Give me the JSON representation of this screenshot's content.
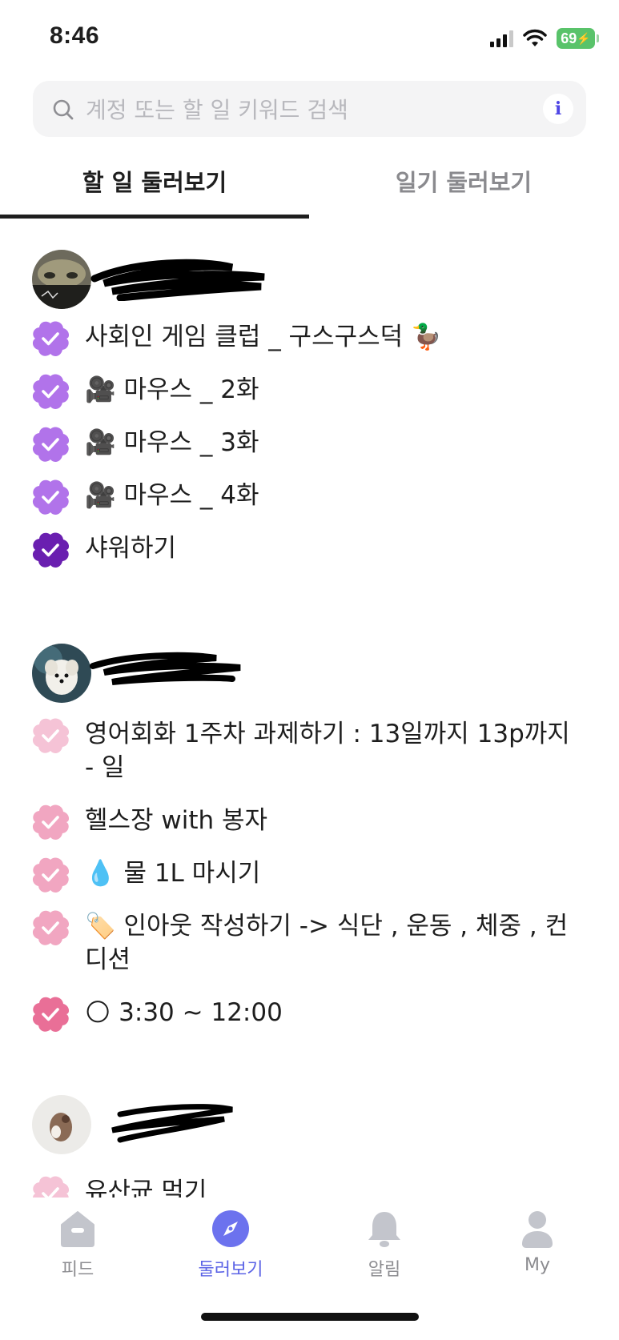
{
  "status_bar": {
    "time": "8:46",
    "battery": "69"
  },
  "search": {
    "placeholder": "계정 또는 할 일 키워드 검색",
    "info_icon": "i"
  },
  "tabs": [
    {
      "label": "할 일 둘러보기",
      "active": true
    },
    {
      "label": "일기 둘러보기",
      "active": false
    }
  ],
  "users": [
    {
      "todos": [
        {
          "text": "사회인 게임 클럽 _ 구스구스덕 🦆",
          "done": true,
          "color": "#b173ea"
        },
        {
          "text": "🎥 마우스 _ 2화",
          "done": true,
          "color": "#b173ea"
        },
        {
          "text": "🎥 마우스 _ 3화",
          "done": true,
          "color": "#b173ea"
        },
        {
          "text": "🎥 마우스 _ 4화",
          "done": true,
          "color": "#b173ea"
        },
        {
          "text": "샤워하기",
          "done": true,
          "color": "#6a1fb0"
        }
      ]
    },
    {
      "todos": [
        {
          "text": "영어회화 1주차 과제하기 : 13일까지 13p까지 - 일",
          "done": true,
          "color": "#f5c3d6"
        },
        {
          "text": "헬스장 with 봉자",
          "done": true,
          "color": "#f1a6c1"
        },
        {
          "text": "💧 물 1L 마시기",
          "done": true,
          "color": "#f1a6c1"
        },
        {
          "text": "🏷️ 인아웃 작성하기 -> 식단 , 운동 , 체중 , 컨디션",
          "done": true,
          "color": "#f1a6c1"
        },
        {
          "text": "🌕 3:30 ~ 12:00",
          "done": true,
          "color": "#e96f97"
        }
      ]
    },
    {
      "todos": [
        {
          "text": "유산균 먹기",
          "done": true,
          "color": "#f5c3d6"
        }
      ]
    }
  ],
  "bottom_nav": [
    {
      "label": "피드",
      "icon": "home-icon",
      "active": false
    },
    {
      "label": "둘러보기",
      "icon": "compass-icon",
      "active": true
    },
    {
      "label": "알림",
      "icon": "bell-icon",
      "active": false
    },
    {
      "label": "My",
      "icon": "profile-icon",
      "active": false
    }
  ]
}
